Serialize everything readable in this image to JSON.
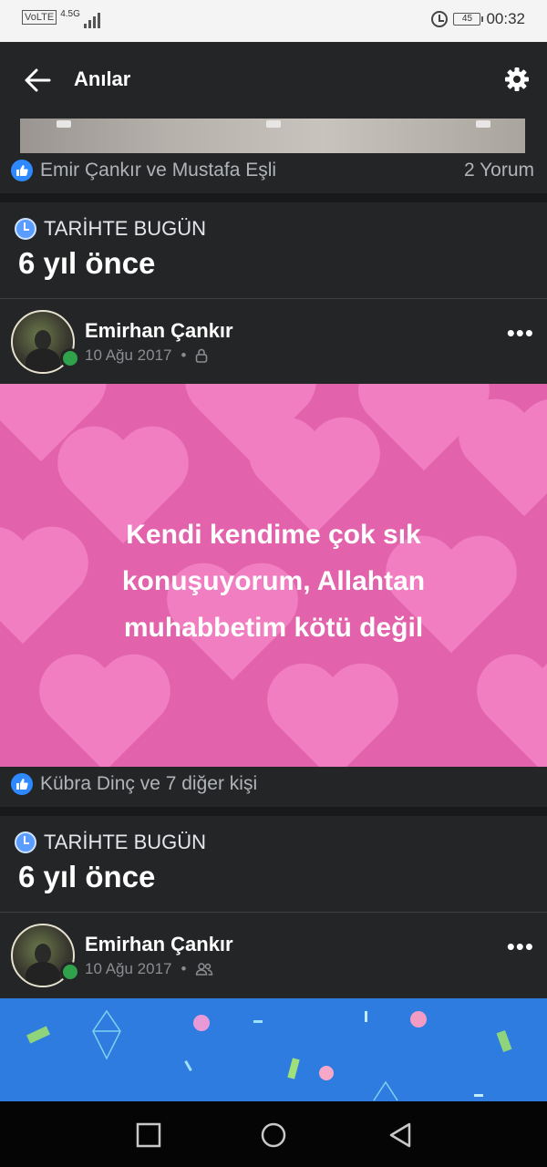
{
  "status_bar": {
    "carrier_badge": "VoLTE",
    "network": "4.5G",
    "battery": "45",
    "time": "00:32"
  },
  "app_bar": {
    "title": "Anılar",
    "back_icon": "arrow-left-icon",
    "settings_icon": "gear-icon"
  },
  "top_card": {
    "reactions_text": "Emir Çankır ve Mustafa Eşli",
    "comments_text": "2 Yorum"
  },
  "memories": [
    {
      "section_label": "TARİHTE BUGÜN",
      "years_ago": "6 yıl önce",
      "author": "Emirhan Çankır",
      "date": "10 Ağu 2017",
      "separator": "•",
      "privacy_icon": "lock-icon",
      "status_text": "Kendi kendime çok sık konuşuyorum, Allahtan muhabbetim kötü değil",
      "reactions_text": "Kübra Dinç ve 7 diğer kişi"
    },
    {
      "section_label": "TARİHTE BUGÜN",
      "years_ago": "6 yıl önce",
      "author": "Emirhan Çankır",
      "date": "10 Ağu 2017",
      "separator": "•",
      "privacy_icon": "friends-icon"
    }
  ],
  "colors": {
    "background": "#18191a",
    "card": "#242526",
    "status_post_bg": "#e263ab",
    "blue_post_bg": "#2f7ce0",
    "online_dot": "#31a24c",
    "like_blue": "#2e89ff"
  },
  "nav_bar": {
    "recents_icon": "square-icon",
    "home_icon": "circle-icon",
    "back_icon": "triangle-back-icon"
  }
}
